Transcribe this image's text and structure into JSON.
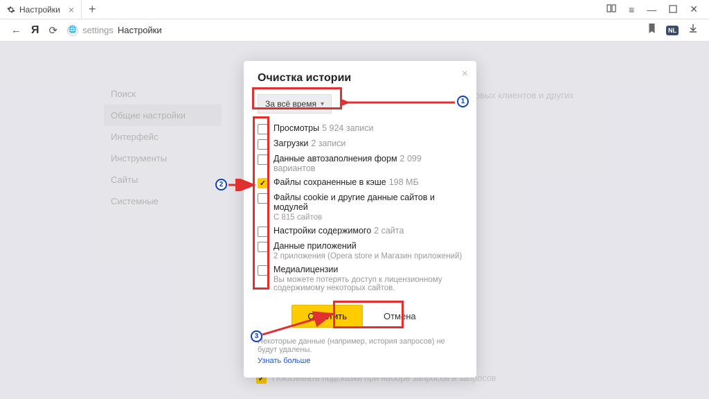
{
  "window": {
    "tab_title": "Настройки",
    "addr_prefix": "settings",
    "addr_rest": "Настройки",
    "nl_badge": "NL"
  },
  "sidebar": {
    "items": [
      {
        "label": "Поиск"
      },
      {
        "label": "Общие настройки"
      },
      {
        "label": "Интерфейс"
      },
      {
        "label": "Инструменты"
      },
      {
        "label": "Сайты"
      },
      {
        "label": "Системные"
      }
    ]
  },
  "bgtext": "товых клиентов и других",
  "bgcheck": "Показывать подсказки при наборе запросов и запросов",
  "dialog": {
    "title": "Очистка истории",
    "time_select": "За всё время",
    "items": [
      {
        "label": "Просмотры",
        "count": "5 924 записи",
        "checked": false
      },
      {
        "label": "Загрузки",
        "count": "2 записи",
        "checked": false
      },
      {
        "label": "Данные автозаполнения форм",
        "count": "2 099 вариантов",
        "checked": false
      },
      {
        "label": "Файлы сохраненные в кэше",
        "count": "198 МБ",
        "checked": true
      },
      {
        "label": "Файлы cookie и другие данные сайтов и модулей",
        "desc": "С 815 сайтов",
        "checked": false
      },
      {
        "label": "Настройки содержимого",
        "count": "2 сайта",
        "checked": false
      },
      {
        "label": "Данные приложений",
        "desc": "2 приложения (Opera store и Магазин приложений)",
        "checked": false
      },
      {
        "label": "Медиалицензии",
        "desc": "Вы можете потерять доступ к лицензионному содержимому некоторых сайтов.",
        "checked": false
      }
    ],
    "btn_primary": "Очистить",
    "btn_cancel": "Отмена",
    "footer": "Некоторые данные (например, история запросов) не будут удалены.",
    "footer_link": "Узнать больше"
  },
  "annotations": {
    "badge1": "1",
    "badge2": "2",
    "badge3": "3"
  }
}
